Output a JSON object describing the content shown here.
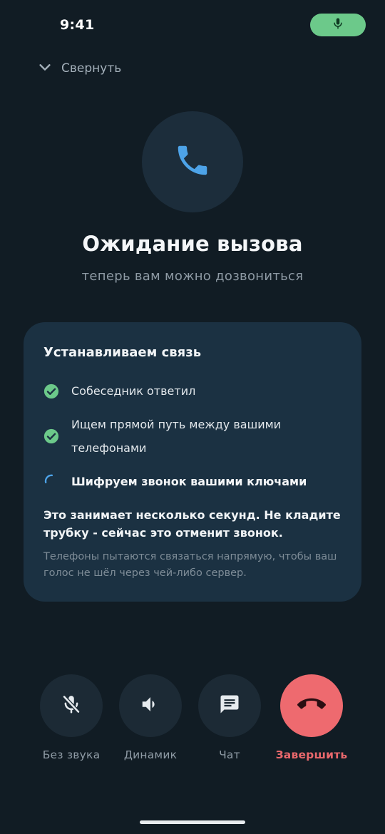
{
  "status_bar": {
    "time": "9:41",
    "mic_indicator_icon": "mic-icon",
    "mic_indicator_color": "#6cc98a"
  },
  "collapse": {
    "icon": "chevron-down-icon",
    "label": "Свернуть"
  },
  "call": {
    "avatar_icon": "phone-icon",
    "title": "Ожидание вызова",
    "subtitle": "теперь вам можно дозвониться"
  },
  "connection_card": {
    "title": "Устанавливаем связь",
    "steps": [
      {
        "label": "Собеседник ответил",
        "status": "done",
        "icon": "check-circle-icon"
      },
      {
        "label": "Ищем прямой путь между вашими телефонами",
        "status": "done",
        "icon": "check-circle-icon"
      },
      {
        "label": "Шифруем звонок вашими ключами",
        "status": "in-progress",
        "icon": "spinner-icon"
      }
    ],
    "warning": "Это занимает несколько секунд. Не кладите трубку - сейчас это отменит звонок.",
    "note": "Телефоны пытаются связаться напрямую, чтобы ваш голос не шёл через чей-либо сервер."
  },
  "controls": [
    {
      "label": "Без звука",
      "icon": "mic-off-icon"
    },
    {
      "label": "Динамик",
      "icon": "speaker-icon"
    },
    {
      "label": "Чат",
      "icon": "chat-icon"
    },
    {
      "label": "Завершить",
      "icon": "hang-up-icon"
    }
  ],
  "colors": {
    "background": "#111c24",
    "card": "#1b3142",
    "accent_blue": "#4da3e8",
    "success_green": "#6cc98a",
    "danger_red": "#ee6a6f"
  }
}
